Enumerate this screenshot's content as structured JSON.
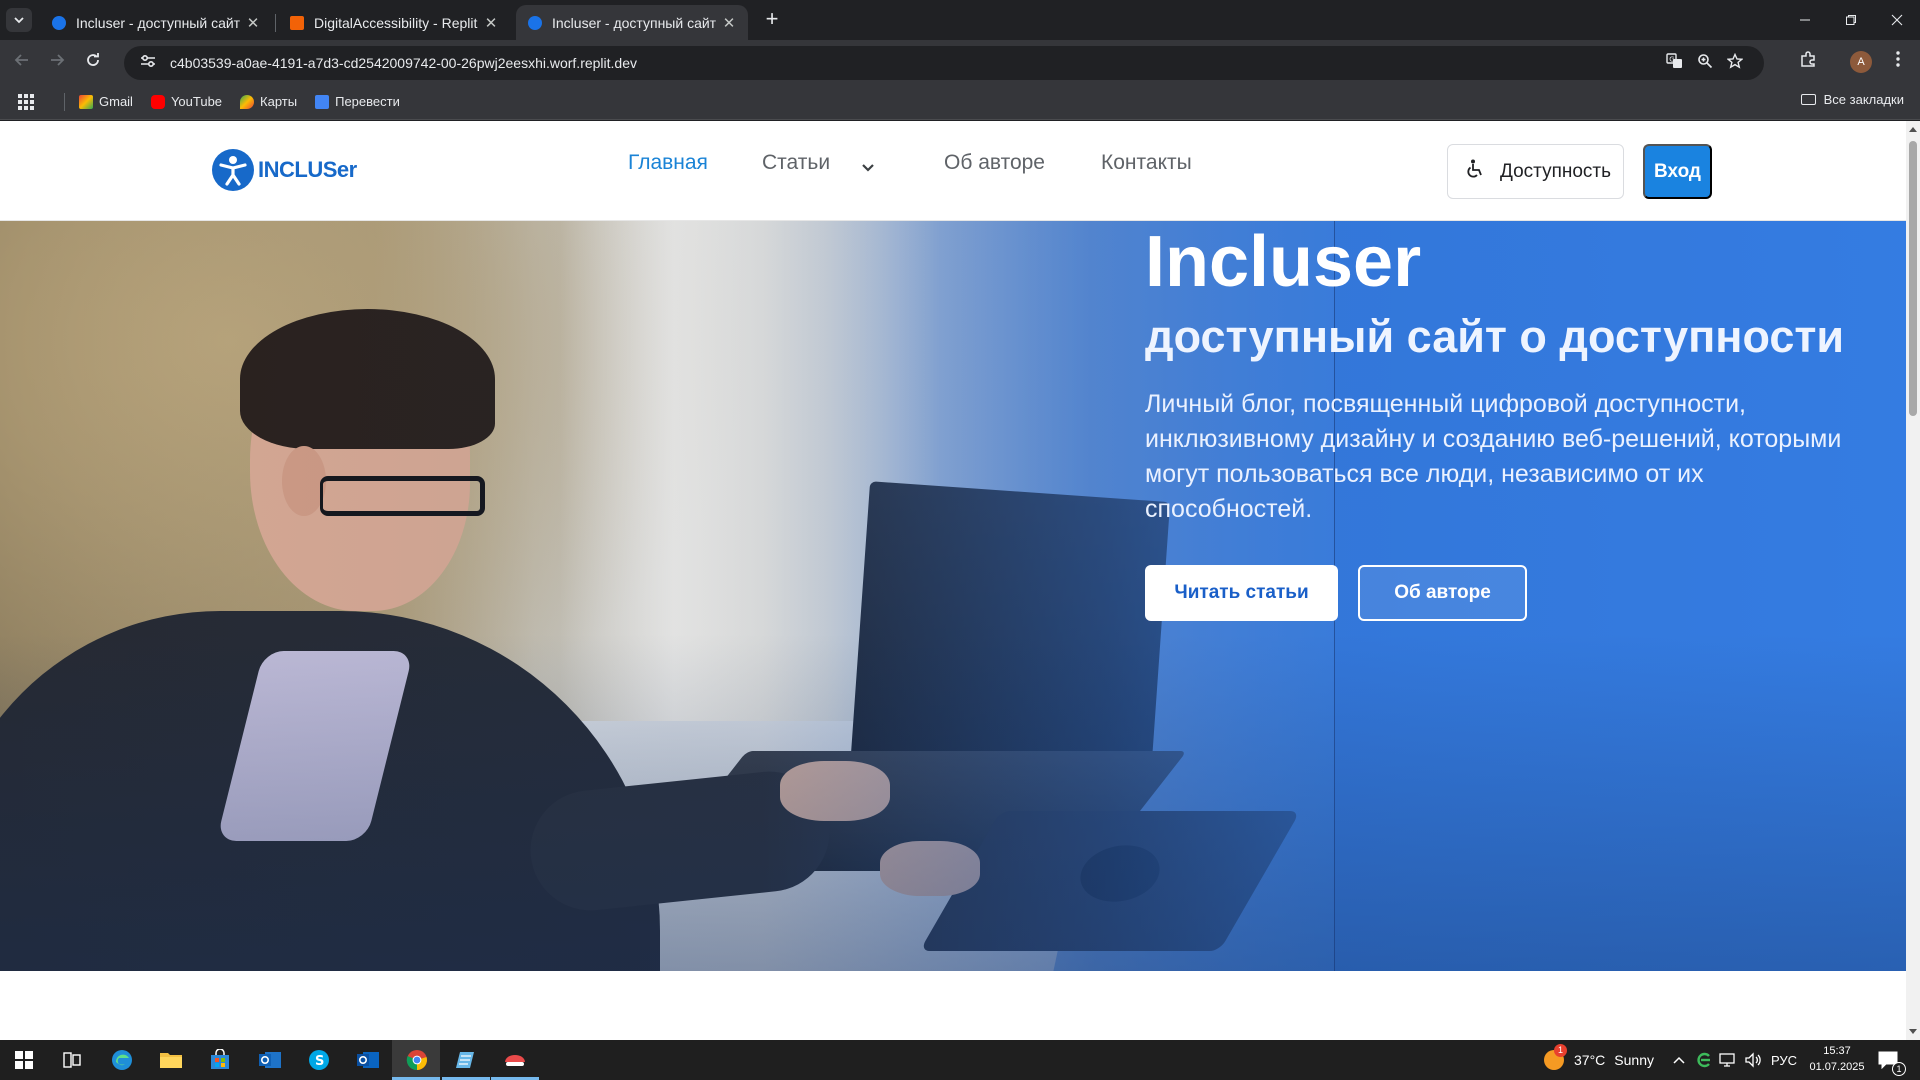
{
  "browser": {
    "tabs": [
      {
        "title": "Incluser - доступный сайт о до",
        "active": false,
        "favicon": "incluser-favicon"
      },
      {
        "title": "DigitalAccessibility - Replit",
        "active": false,
        "favicon": "replit-favicon"
      },
      {
        "title": "Incluser - доступный сайт о до",
        "active": true,
        "favicon": "incluser-favicon"
      }
    ],
    "url": "c4b03539-a0ae-4191-a7d3-cd2542009742-00-26pwj2eesxhi.worf.replit.dev",
    "avatar_letter": "A",
    "bookmarks": [
      {
        "label": "Gmail",
        "icon": "gmail-icon",
        "color": "#ea4335"
      },
      {
        "label": "YouTube",
        "icon": "youtube-icon",
        "color": "#ff0000"
      },
      {
        "label": "Карты",
        "icon": "maps-icon",
        "color": "#34a853"
      },
      {
        "label": "Перевести",
        "icon": "translate-icon",
        "color": "#4285f4"
      }
    ],
    "all_bookmarks_label": "Все закладки"
  },
  "site": {
    "logo_text": "INCLUSer",
    "nav": [
      {
        "label": "Главная",
        "active": true
      },
      {
        "label": "Статьи",
        "active": false,
        "dropdown": true
      },
      {
        "label": "Об авторе",
        "active": false
      },
      {
        "label": "Контакты",
        "active": false
      }
    ],
    "accessibility_button": "Доступность",
    "login_button": "Вход",
    "hero": {
      "title": "Incluser",
      "subtitle": "доступный сайт о доступности",
      "description": "Личный блог, посвященный цифровой доступности, инклюзивному дизайну и созданию веб-решений, которыми могут пользоваться все люди, независимо от их способностей.",
      "primary_button": "Читать статьи",
      "secondary_button": "Об авторе"
    },
    "accent_color": "#1a83e0"
  },
  "taskbar": {
    "weather_temp": "37°C",
    "weather_text": "Sunny",
    "weather_badge": "1",
    "language": "РУС",
    "time": "15:37",
    "date": "01.07.2025",
    "notification_count": "1"
  }
}
